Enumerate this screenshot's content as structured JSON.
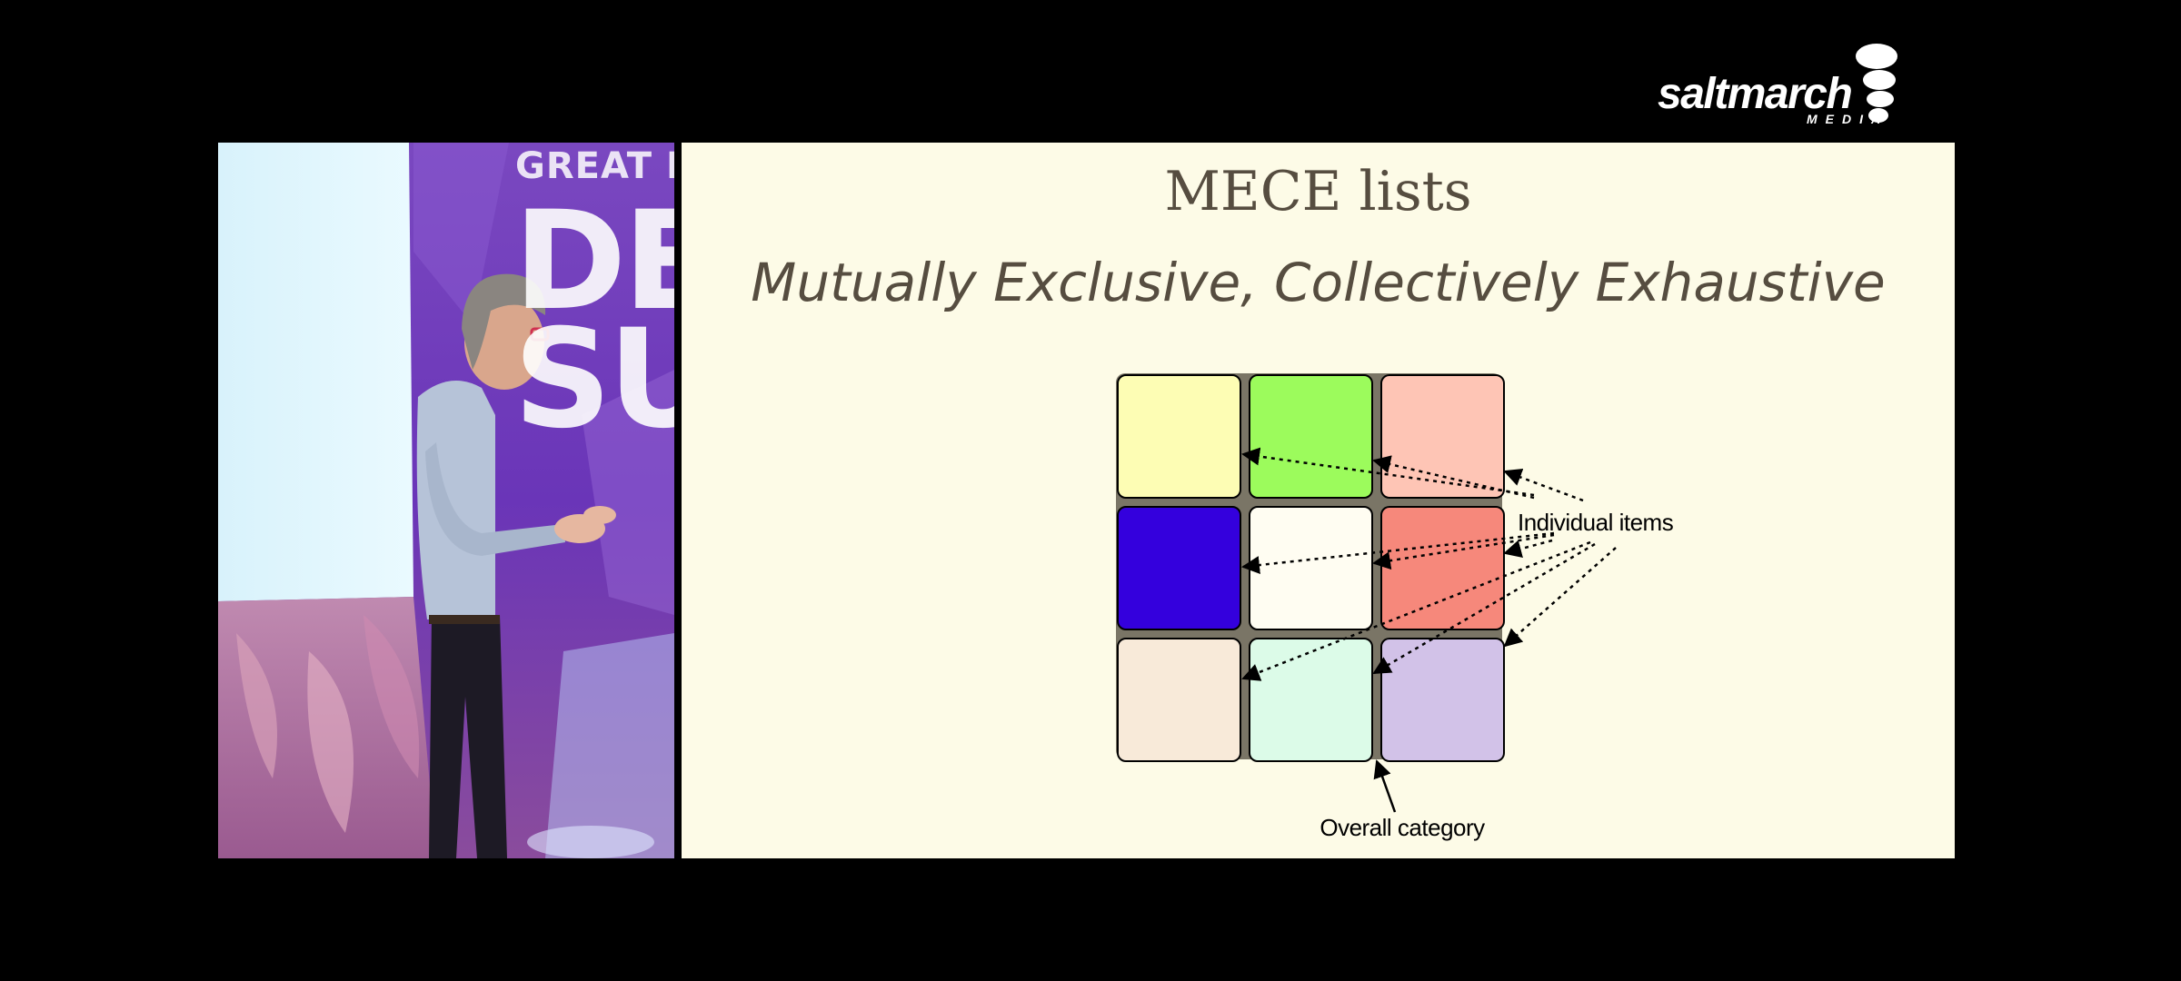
{
  "logo": {
    "wordmark": "saltmarch",
    "sub": "MEDIA"
  },
  "camera": {
    "stage_line_1": "GREAT IN",
    "stage_line_2": "DE",
    "stage_line_3": "SU"
  },
  "slide": {
    "title": "MECE lists",
    "subtitle": "Mutually Exclusive, Collectively Exhaustive",
    "diagram": {
      "grid_colors": [
        [
          "#fdfdb4",
          "#9cfb5c",
          "#fec5b5"
        ],
        [
          "#3400dd",
          "#fffdf2",
          "#f6887b"
        ],
        [
          "#f8ead9",
          "#dcfbe8",
          "#d2c2e8"
        ]
      ],
      "grid_background": "#7a7566",
      "label_items": "Individual items",
      "label_category": "Overall category"
    }
  },
  "colors": {
    "slide_background": "#fdfbe7",
    "slide_text": "#564d40",
    "frame_background": "#000000"
  }
}
